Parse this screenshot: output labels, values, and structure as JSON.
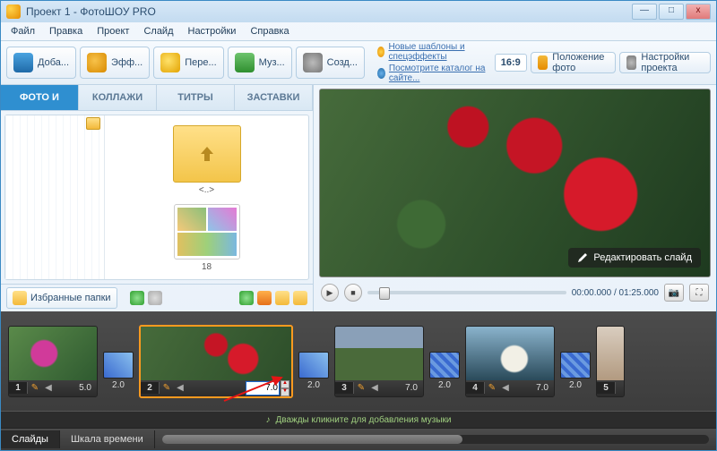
{
  "title": "Проект 1 - ФотоШОУ PRO",
  "win_buttons": {
    "min": "—",
    "max": "□",
    "close": "x"
  },
  "menu": [
    "Файл",
    "Правка",
    "Проект",
    "Слайд",
    "Настройки",
    "Справка"
  ],
  "toolbar": {
    "add": "Доба...",
    "effects": "Эфф...",
    "trans": "Пере...",
    "music": "Муз...",
    "create": "Созд...",
    "link1": "Новые шаблоны и спецэффекты",
    "link2": "Посмотрите каталог на сайте...",
    "ratio": "16:9",
    "photo_pos": "Положение фото",
    "proj_settings": "Настройки проекта"
  },
  "tabs": {
    "t1": "ФОТО И ВИДЕО",
    "t2": "КОЛЛАЖИ",
    "t3": "ТИТРЫ",
    "t4": "ЗАСТАВКИ"
  },
  "thumbs": {
    "up": "<..>",
    "item": "18"
  },
  "fav": {
    "label": "Избранные папки"
  },
  "preview": {
    "edit": "Редактировать слайд",
    "time": "00:00.000 / 01:25.000"
  },
  "timeline": {
    "slides": [
      {
        "n": "1",
        "dur": "5.0"
      },
      {
        "n": "2",
        "dur": "7.0"
      },
      {
        "n": "3",
        "dur": "7.0"
      },
      {
        "n": "4",
        "dur": "7.0"
      },
      {
        "n": "5",
        "dur": ""
      }
    ],
    "trans_dur": "2.0",
    "music": "Дважды кликните для добавления музыки",
    "tab_slides": "Слайды",
    "tab_scale": "Шкала времени"
  }
}
